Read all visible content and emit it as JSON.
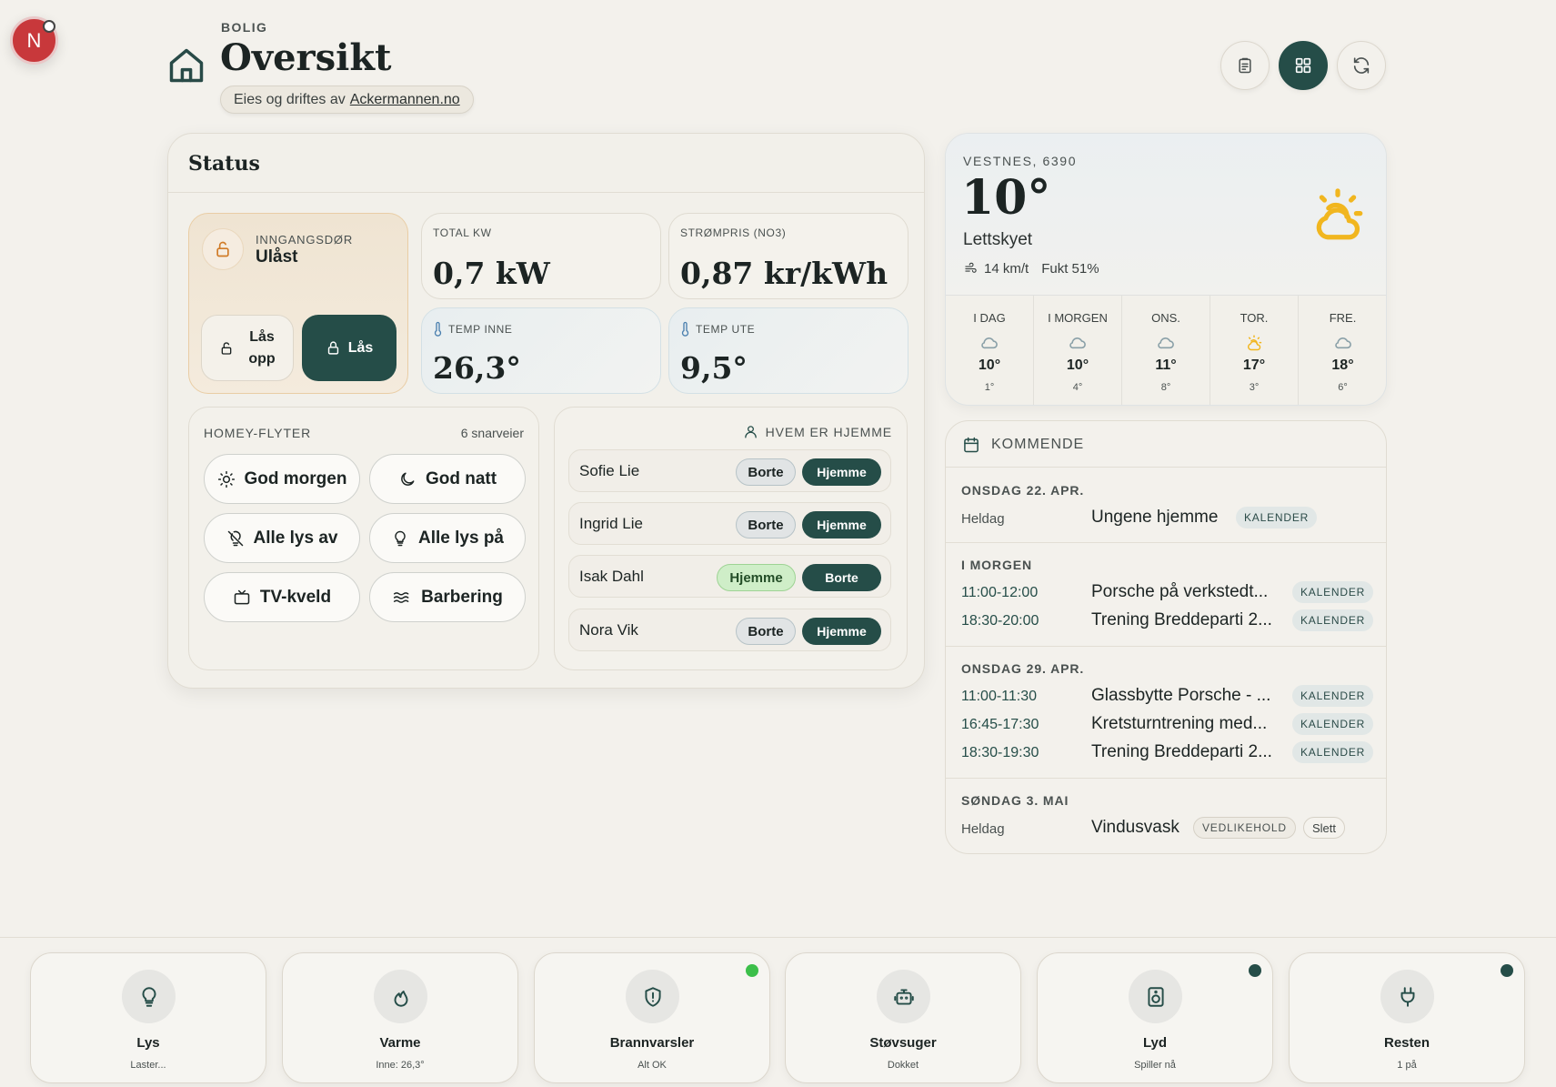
{
  "avatar": {
    "initial": "N"
  },
  "header": {
    "kicker": "BOLIG",
    "title": "Oversikt",
    "owner_prefix": "Eies og driftes av",
    "owner_link": "Ackermannen.no"
  },
  "status": {
    "title": "Status",
    "door": {
      "label": "INNGANGSDØR",
      "value": "Ulåst",
      "unlock_label_1": "Lås",
      "unlock_label_2": "opp",
      "lock_label": "Lås"
    },
    "metrics": {
      "total_kw": {
        "label": "TOTAL KW",
        "value": "0,7 kW"
      },
      "price": {
        "label": "STRØMPRIS (NO3)",
        "value": "0,87 kr/kWh"
      },
      "temp_in": {
        "label": "TEMP INNE",
        "value": "26,3°"
      },
      "temp_out": {
        "label": "TEMP UTE",
        "value": "9,5°"
      }
    },
    "flows": {
      "label": "HOMEY-FLYTER",
      "count": "6 snarveier",
      "items": [
        {
          "label": "God morgen",
          "icon": "sun-icon"
        },
        {
          "label": "God natt",
          "icon": "moon-icon"
        },
        {
          "label": "Alle lys av",
          "icon": "bulb-off-icon"
        },
        {
          "label": "Alle lys på",
          "icon": "bulb-icon"
        },
        {
          "label": "TV-kveld",
          "icon": "tv-icon"
        },
        {
          "label": "Barbering",
          "icon": "waves-icon"
        }
      ]
    },
    "presence": {
      "label": "HVEM ER HJEMME",
      "people": [
        {
          "name": "Sofie Lie",
          "pill1": "Borte",
          "pill2": "Hjemme"
        },
        {
          "name": "Ingrid Lie",
          "pill1": "Borte",
          "pill2": "Hjemme"
        },
        {
          "name": "Isak Dahl",
          "pill1": "Hjemme",
          "pill2": "Borte"
        },
        {
          "name": "Nora Vik",
          "pill1": "Borte",
          "pill2": "Hjemme"
        }
      ]
    }
  },
  "weather": {
    "location": "VESTNES, 6390",
    "temp": "10°",
    "condition": "Lettskyet",
    "wind": "14 km/t",
    "humidity": "Fukt 51%",
    "days": [
      {
        "name": "I DAG",
        "high": "10°",
        "low": "1°",
        "icon": "cloud-icon"
      },
      {
        "name": "I MORGEN",
        "high": "10°",
        "low": "4°",
        "icon": "cloud-icon"
      },
      {
        "name": "ONS.",
        "high": "11°",
        "low": "8°",
        "icon": "cloud-icon"
      },
      {
        "name": "TOR.",
        "high": "17°",
        "low": "3°",
        "icon": "partly-sunny-icon"
      },
      {
        "name": "FRE.",
        "high": "18°",
        "low": "6°",
        "icon": "cloud-icon"
      }
    ]
  },
  "upcoming": {
    "title": "KOMMENDE",
    "groups": [
      {
        "date": "ONSDAG 22. APR.",
        "events": [
          {
            "time": "Heldag",
            "title": "Ungene hjemme",
            "tag": "KALENDER"
          }
        ]
      },
      {
        "date": "I MORGEN",
        "events": [
          {
            "time": "11:00-12:00",
            "title": "Porsche på verkstedt...",
            "tag": "KALENDER"
          },
          {
            "time": "18:30-20:00",
            "title": "Trening Breddeparti 2...",
            "tag": "KALENDER"
          }
        ]
      },
      {
        "date": "ONSDAG 29. APR.",
        "events": [
          {
            "time": "11:00-11:30",
            "title": "Glassbytte Porsche - ...",
            "tag": "KALENDER"
          },
          {
            "time": "16:45-17:30",
            "title": "Kretsturntrening med...",
            "tag": "KALENDER"
          },
          {
            "time": "18:30-19:30",
            "title": "Trening Breddeparti 2...",
            "tag": "KALENDER"
          }
        ]
      },
      {
        "date": "SØNDAG 3. MAI",
        "events": [
          {
            "time": "Heldag",
            "title": "Vindusvask",
            "tag": "VEDLIKEHOLD",
            "action": "Slett"
          }
        ]
      }
    ]
  },
  "dock": {
    "tiles": [
      {
        "name": "Lys",
        "sub": "Laster...",
        "icon": "bulb-icon"
      },
      {
        "name": "Varme",
        "sub": "Inne: 26,3°",
        "icon": "flame-icon"
      },
      {
        "name": "Brannvarsler",
        "sub": "Alt OK",
        "icon": "shield-alert-icon",
        "indicator": "#3cbf4a"
      },
      {
        "name": "Støvsuger",
        "sub": "Dokket",
        "icon": "robot-icon"
      },
      {
        "name": "Lyd",
        "sub": "Spiller nå",
        "icon": "speaker-icon",
        "indicator": "#254d48"
      },
      {
        "name": "Resten",
        "sub": "1 på",
        "icon": "plug-icon",
        "indicator": "#254d48"
      }
    ]
  },
  "colors": {
    "accent": "#254d48",
    "warn": "#d07b27",
    "sun": "#f1b61f",
    "ok": "#3cbf4a"
  }
}
